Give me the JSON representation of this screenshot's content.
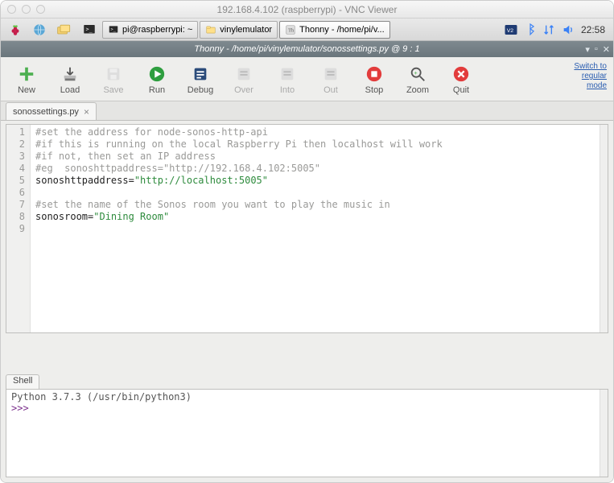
{
  "mac_title": "192.168.4.102 (raspberrypi) - VNC Viewer",
  "taskbar": {
    "tasks": [
      {
        "label": "pi@raspberrypi: ~",
        "icon": "terminal"
      },
      {
        "label": "vinylemulator",
        "icon": "folder"
      },
      {
        "label": "Thonny  -  /home/pi/v...",
        "icon": "thonny",
        "active": true
      }
    ],
    "clock": "22:58"
  },
  "thonny": {
    "title": "Thonny  -  /home/pi/vinylemulator/sonossettings.py  @  9 : 1",
    "switch_link": "Switch to\nregular\nmode"
  },
  "toolbar": [
    {
      "key": "new",
      "label": "New",
      "enabled": true
    },
    {
      "key": "load",
      "label": "Load",
      "enabled": true
    },
    {
      "key": "save",
      "label": "Save",
      "enabled": false
    },
    {
      "key": "run",
      "label": "Run",
      "enabled": true
    },
    {
      "key": "debug",
      "label": "Debug",
      "enabled": true
    },
    {
      "key": "over",
      "label": "Over",
      "enabled": false
    },
    {
      "key": "into",
      "label": "Into",
      "enabled": false
    },
    {
      "key": "out",
      "label": "Out",
      "enabled": false
    },
    {
      "key": "stop",
      "label": "Stop",
      "enabled": true
    },
    {
      "key": "zoom",
      "label": "Zoom",
      "enabled": true
    },
    {
      "key": "quit",
      "label": "Quit",
      "enabled": true
    }
  ],
  "file_tab": "sonossettings.py",
  "code": {
    "lines": [
      {
        "n": 1,
        "type": "comment",
        "text": "#set the address for node-sonos-http-api"
      },
      {
        "n": 2,
        "type": "comment",
        "text": "#if this is running on the local Raspberry Pi then localhost will work"
      },
      {
        "n": 3,
        "type": "comment",
        "text": "#if not, then set an IP address"
      },
      {
        "n": 4,
        "type": "comment",
        "text": "#eg  sonoshttpaddress=\"http://192.168.4.102:5005\""
      },
      {
        "n": 5,
        "type": "assign",
        "lhs": "sonoshttpaddress=",
        "str": "\"http://localhost:5005\""
      },
      {
        "n": 6,
        "type": "blank",
        "text": ""
      },
      {
        "n": 7,
        "type": "comment",
        "text": "#set the name of the Sonos room you want to play the music in"
      },
      {
        "n": 8,
        "type": "assign",
        "lhs": "sonosroom=",
        "str": "\"Dining Room\""
      },
      {
        "n": 9,
        "type": "blank",
        "text": ""
      }
    ]
  },
  "shell": {
    "tab": "Shell",
    "banner": "Python 3.7.3 (/usr/bin/python3)",
    "prompt": ">>> "
  }
}
